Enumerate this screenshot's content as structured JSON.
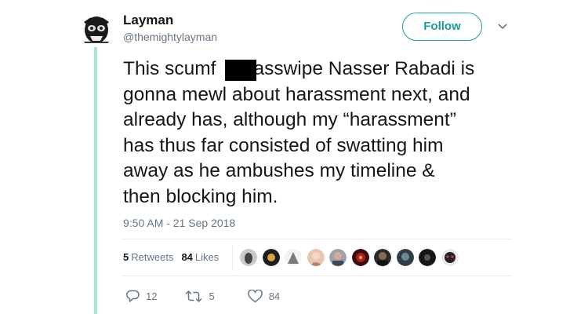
{
  "author": {
    "name": "Layman",
    "handle": "@themightylayman"
  },
  "follow_label": "Follow",
  "tweet": {
    "line1_before": "This scumf",
    "line1_after": "asswipe Nasser Rabadi is",
    "rest": "gonna mewl about harassment next, and\nalready has, although my “harassment”\nhas thus far consisted of swatting him\naway as he ambushes my timeline &\nthen blocking him."
  },
  "timestamp": "9:50 AM - 21 Sep 2018",
  "stats": {
    "retweets_count": "5",
    "retweets_label": "Retweets",
    "likes_count": "84",
    "likes_label": "Likes"
  },
  "actions": {
    "replies": "12",
    "retweets": "5",
    "likes": "84"
  },
  "icons": [
    "avatar-icon",
    "chevron-down-icon",
    "reply-icon",
    "retweet-icon",
    "heart-icon"
  ],
  "colors": {
    "accent_bar": "#a8e4d0",
    "follow": "#1a9c9c",
    "muted": "#657786"
  }
}
